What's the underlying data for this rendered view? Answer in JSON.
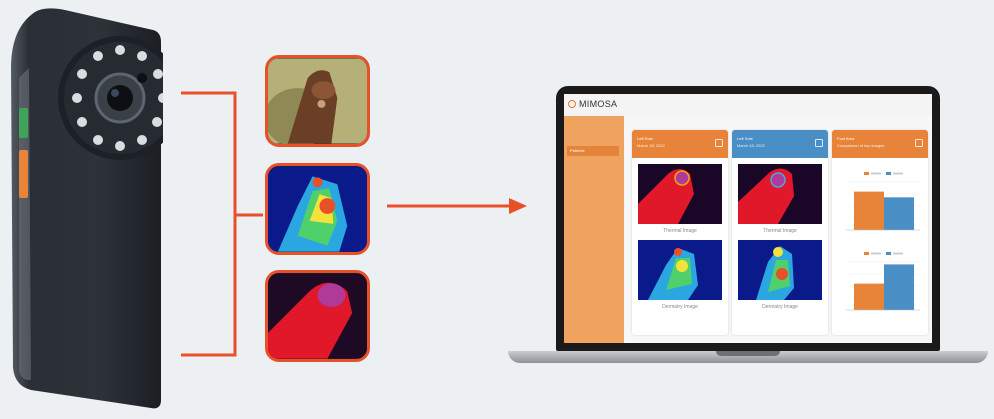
{
  "app": {
    "logo_text": "MIMOSA",
    "sidebar_item": "Patients",
    "columns": [
      {
        "title": "Left Sole",
        "subtitle": "March 18, 2022",
        "color": "#e8843a",
        "captions": [
          "Thermal Image",
          "Dermatry Image"
        ]
      },
      {
        "title": "Left Sole",
        "subtitle": "March 18, 2022",
        "color": "#4a8ec6",
        "captions": [
          "Thermal Image",
          "Dermatry Image"
        ]
      },
      {
        "title": "Foot Area",
        "subtitle": "Comparison of two images",
        "color": "#e8843a"
      }
    ]
  },
  "chart_data": [
    {
      "type": "bar",
      "categories": [
        "Image 1",
        "Image 2"
      ],
      "values": [
        0.8,
        0.68
      ],
      "colors": [
        "#e8843a",
        "#4a8ec6"
      ],
      "legend": "top"
    },
    {
      "type": "bar",
      "categories": [
        "Image 1",
        "Image 2"
      ],
      "values": [
        0.55,
        0.95
      ],
      "colors": [
        "#e8843a",
        "#4a8ec6"
      ],
      "legend": "top"
    }
  ],
  "colors": {
    "accent": "#e8502a",
    "device_body": "#2b3038",
    "button_green": "#3fa35a",
    "button_orange": "#e8843a"
  }
}
